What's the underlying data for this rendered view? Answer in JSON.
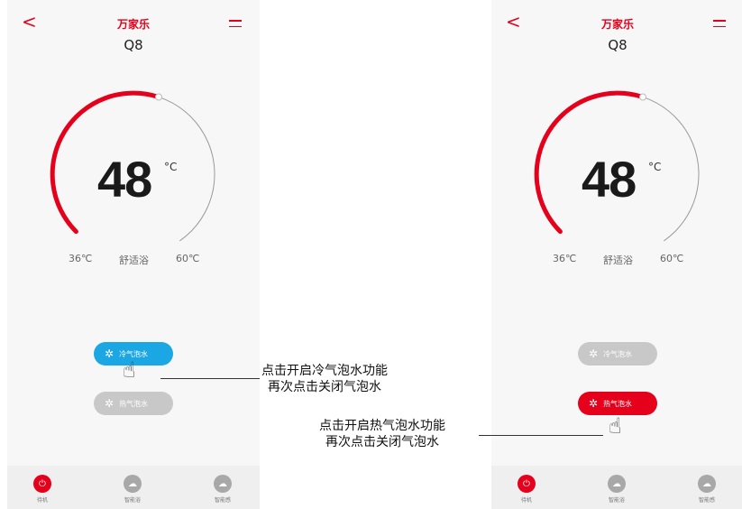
{
  "app": {
    "brand": "万家乐",
    "model": "Q8"
  },
  "screens": [
    {
      "temperature": "48",
      "unit": "°C",
      "range_min": "36℃",
      "mode": "舒适浴",
      "range_max": "60℃",
      "button_cold": "冷气泡水",
      "button_hot": "热气泡水",
      "tabs": [
        "待机",
        "智能浴",
        "智能感"
      ]
    },
    {
      "temperature": "48",
      "unit": "°C",
      "range_min": "36℃",
      "mode": "舒适浴",
      "range_max": "60℃",
      "button_cold": "冷气泡水",
      "button_hot": "热气泡水",
      "tabs": [
        "待机",
        "智能浴",
        "智能感"
      ]
    }
  ],
  "callouts": {
    "cold_line1": "点击开启冷气泡水功能",
    "cold_line2": "再次点击关闭气泡水",
    "hot_line1": "点击开启热气泡水功能",
    "hot_line2": "再次点击关闭气泡水"
  },
  "colors": {
    "accent": "#e5001b",
    "cold_active": "#1ba6e4",
    "inactive": "#c8c8c8"
  }
}
